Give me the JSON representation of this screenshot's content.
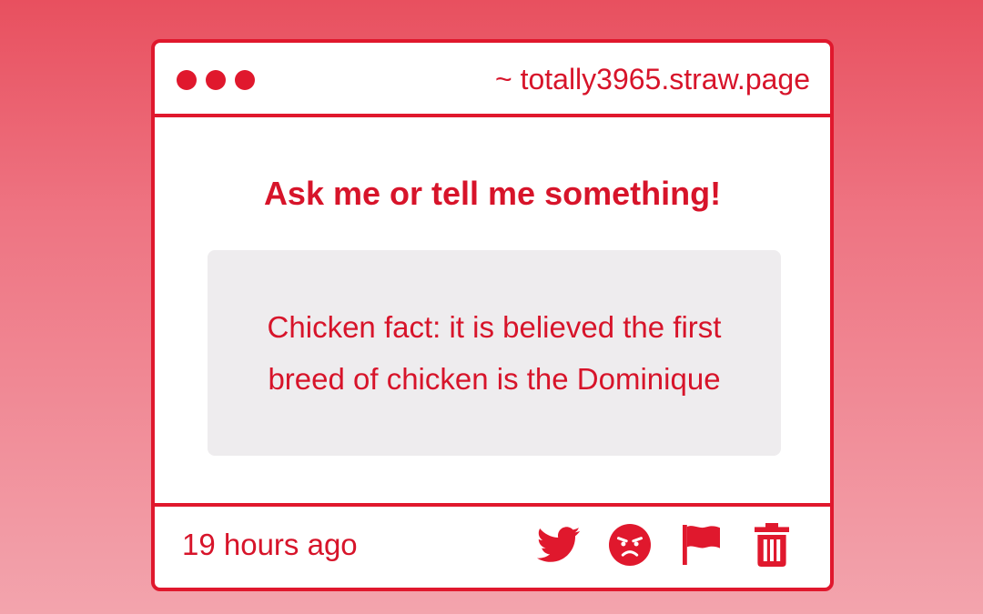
{
  "window": {
    "url": "~ totally3965.straw.page",
    "dots": [
      "red-dot",
      "red-dot",
      "red-dot"
    ]
  },
  "main": {
    "prompt": "Ask me or tell me something!",
    "message": "Chicken fact: it is believed the first breed of chicken is the Dominique"
  },
  "footer": {
    "timestamp": "19 hours ago",
    "actions": [
      {
        "icon": "twitter-icon"
      },
      {
        "icon": "angry-face-icon"
      },
      {
        "icon": "flag-icon"
      },
      {
        "icon": "trash-icon"
      }
    ]
  },
  "colors": {
    "accent": "#e0182d",
    "text": "#d7142a",
    "message_background": "#eeecee",
    "background_top": "#e8505f",
    "background_bottom": "#f3a4ad"
  }
}
